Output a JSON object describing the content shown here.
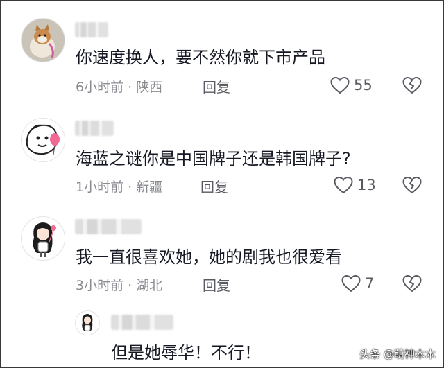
{
  "comments": [
    {
      "text": "你速度换人，要不然你就下市产品",
      "time": "6小时前",
      "sep": "·",
      "location": "陕西",
      "reply": "回复",
      "likes": "55"
    },
    {
      "text": "海蓝之谜你是中国牌子还是韩国牌子?",
      "time": "1小时前",
      "sep": "·",
      "location": "新疆",
      "reply": "回复",
      "likes": "13"
    },
    {
      "text": "我一直很喜欢她，她的剧我也很爱看",
      "time": "3小时前",
      "sep": "·",
      "location": "湖北",
      "reply": "回复",
      "likes": "7"
    }
  ],
  "sub_reply": {
    "text": "但是她辱华！不行！"
  },
  "watermark": "头条 @萌神木木",
  "icons": {
    "like": "heart-outline-icon",
    "dislike": "broken-heart-icon"
  },
  "colors": {
    "text": "#161823",
    "meta": "#8a8b91",
    "icon": "#5a5b62"
  }
}
